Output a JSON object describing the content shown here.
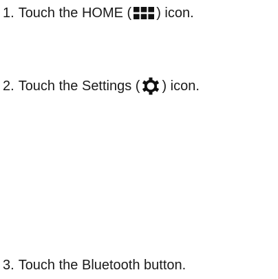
{
  "steps": [
    {
      "number": "1.",
      "text_before": "Touch the HOME (",
      "icon": "home-grid-icon",
      "text_after": ") icon."
    },
    {
      "number": "2.",
      "text_before": "Touch the Settings (",
      "icon": "settings-gear-icon",
      "text_after": ") icon."
    },
    {
      "number": "3.",
      "text": "Touch the Bluetooth button."
    }
  ]
}
